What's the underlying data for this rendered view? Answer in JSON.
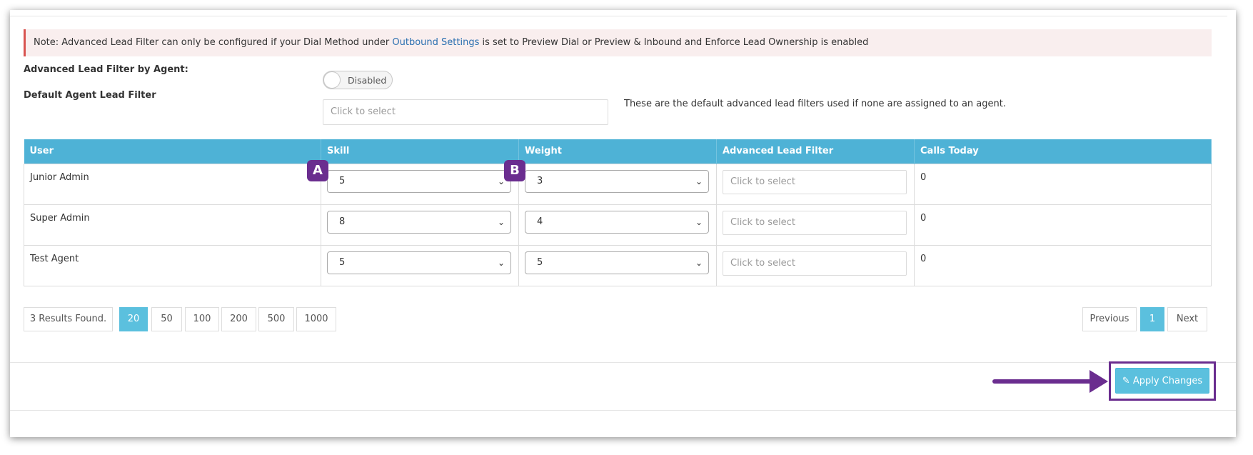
{
  "note": {
    "prefix": "Note: Advanced Lead Filter can only be configured if your Dial Method under ",
    "link": "Outbound Settings",
    "suffix": " is set to Preview Dial or Preview & Inbound and Enforce Lead Ownership is enabled"
  },
  "settings": {
    "filter_by_agent_label": "Advanced Lead Filter by Agent:",
    "toggle_state": "Disabled",
    "default_filter_label": "Default Agent Lead Filter",
    "default_filter_placeholder": "Click to select",
    "default_filter_hint": "These are the default advanced lead filters used if none are assigned to an agent."
  },
  "table": {
    "columns": [
      "User",
      "Skill",
      "Weight",
      "Advanced Lead Filter",
      "Calls Today"
    ],
    "rows": [
      {
        "user": "Junior Admin",
        "skill": "5",
        "weight": "3",
        "filter": "Click to select",
        "calls": "0"
      },
      {
        "user": "Super Admin",
        "skill": "8",
        "weight": "4",
        "filter": "Click to select",
        "calls": "0"
      },
      {
        "user": "Test Agent",
        "skill": "5",
        "weight": "5",
        "filter": "Click to select",
        "calls": "0"
      }
    ]
  },
  "annotations": {
    "a": "A",
    "b": "B"
  },
  "pagination": {
    "results": "3 Results Found.",
    "page_sizes": [
      "20",
      "50",
      "100",
      "200",
      "500",
      "1000"
    ],
    "active_page_size": "20",
    "previous": "Previous",
    "current_page": "1",
    "next": "Next"
  },
  "actions": {
    "apply_label": "Apply Changes",
    "apply_icon": "edit-icon"
  },
  "colors": {
    "header": "#4eb2d6",
    "accent": "#5bc0de",
    "annotation": "#6a2d8f",
    "note_border": "#d9534f"
  }
}
